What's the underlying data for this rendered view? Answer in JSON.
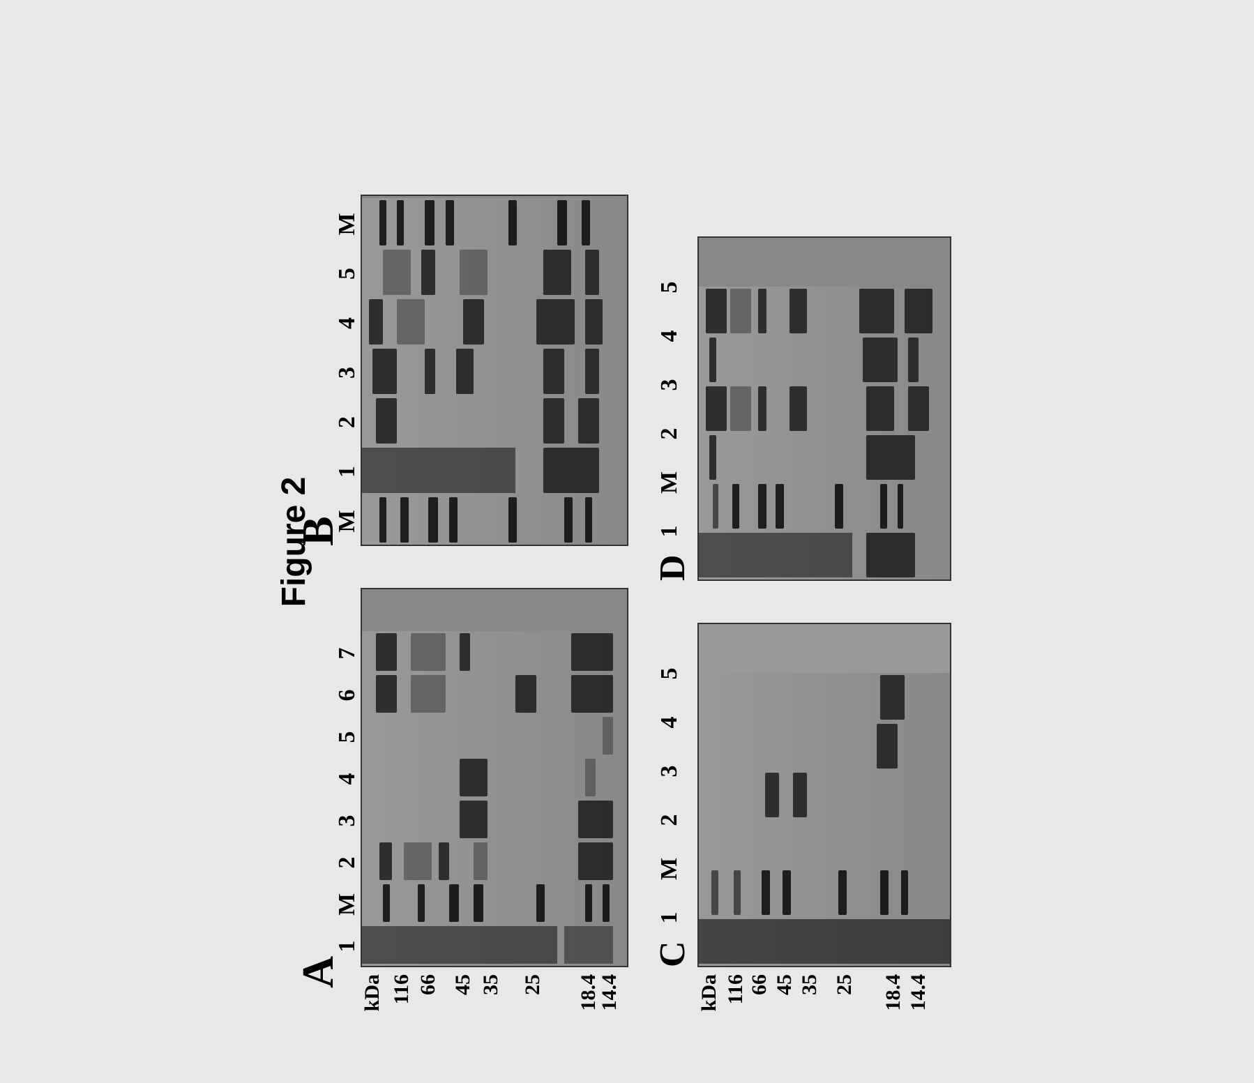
{
  "figure_title": "Figure 2",
  "y_unit": "kDa",
  "markers_top": [
    "116",
    "66",
    "45",
    "35",
    "25",
    "18.4",
    "14.4"
  ],
  "markers_bottom": [
    "116",
    "66",
    "45",
    "35",
    "25",
    "18.4",
    "14.4"
  ],
  "panelA": {
    "label": "A",
    "lanes": [
      "1",
      "M",
      "2",
      "3",
      "4",
      "5",
      "6",
      "7"
    ]
  },
  "panelB": {
    "label": "B",
    "lanes": [
      "M",
      "1",
      "2",
      "3",
      "4",
      "5",
      "M"
    ]
  },
  "panelC": {
    "label": "C",
    "lanes": [
      "1",
      "M",
      "2",
      "3",
      "4",
      "5"
    ]
  },
  "panelD": {
    "label": "D",
    "lanes": [
      "1",
      "M",
      "2",
      "3",
      "4",
      "5"
    ]
  }
}
